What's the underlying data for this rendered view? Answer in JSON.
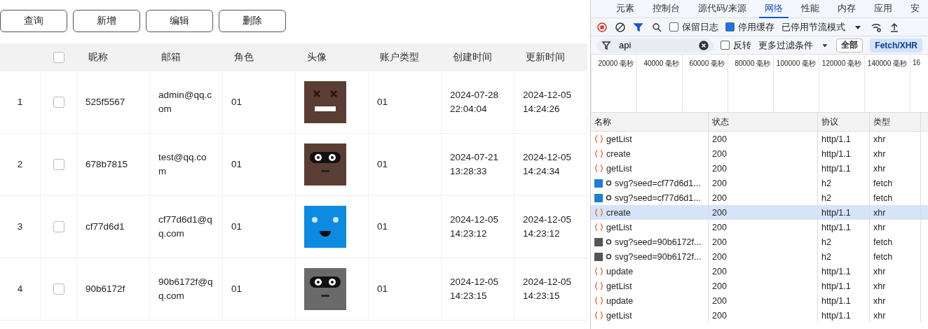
{
  "toolbar_buttons": [
    "查询",
    "新增",
    "编辑",
    "删除"
  ],
  "table": {
    "columns": [
      "昵称",
      "邮箱",
      "角色",
      "头像",
      "账户类型",
      "创建时间",
      "更新时间"
    ],
    "header_checked": false,
    "rows": [
      {
        "index": "1",
        "checked": false,
        "nickname": "525f5567",
        "email": "admin@qq.com",
        "role": "01",
        "avatar": {
          "kind": "x-eyes",
          "color": "#5a3d33"
        },
        "account_type": "01",
        "created": "2024-07-28 22:04:04",
        "updated": "2024-12-05 14:24:26"
      },
      {
        "index": "2",
        "checked": false,
        "nickname": "678b7815",
        "email": "test@qq.com",
        "role": "01",
        "avatar": {
          "kind": "goggles",
          "color": "#5a3d33"
        },
        "account_type": "01",
        "created": "2024-07-21 13:28:33",
        "updated": "2024-12-05 14:24:34"
      },
      {
        "index": "3",
        "checked": false,
        "nickname": "cf77d6d1",
        "email": "cf77d6d1@qq.com",
        "role": "01",
        "avatar": {
          "kind": "glow",
          "color": "#0d8be0"
        },
        "account_type": "01",
        "created": "2024-12-05 14:23:12",
        "updated": "2024-12-05 14:23:12"
      },
      {
        "index": "4",
        "checked": false,
        "nickname": "90b6172f",
        "email": "90b6172f@qq.com",
        "role": "01",
        "avatar": {
          "kind": "goggles",
          "color": "#6a6a6a"
        },
        "account_type": "01",
        "created": "2024-12-05 14:23:15",
        "updated": "2024-12-05 14:23:15"
      }
    ]
  },
  "devtools": {
    "tabs": [
      {
        "label": "元素",
        "selected": false
      },
      {
        "label": "控制台",
        "selected": false
      },
      {
        "label": "源代码/来源",
        "selected": false
      },
      {
        "label": "网络",
        "selected": true
      },
      {
        "label": "性能",
        "selected": false
      },
      {
        "label": "内存",
        "selected": false
      },
      {
        "label": "应用",
        "selected": false
      },
      {
        "label": "安",
        "selected": false
      }
    ],
    "preserve_log": {
      "label": "保留日志",
      "checked": false
    },
    "disable_cache": {
      "label": "停用缓存",
      "checked": true
    },
    "throttling": "已停用节流模式",
    "filter": {
      "value": "api"
    },
    "invert": {
      "label": "反转",
      "checked": false
    },
    "more_filters": "更多过滤条件",
    "type_filters": [
      {
        "label": "全部",
        "selected": false
      },
      {
        "label": "Fetch/XHR",
        "selected": true
      }
    ],
    "timeline_labels": [
      "20000 毫秒",
      "40000 毫秒",
      "60000 毫秒",
      "80000 毫秒",
      "100000 毫秒",
      "120000 毫秒",
      "140000 毫秒",
      "16"
    ],
    "columns": [
      "名称",
      "状态",
      "协议",
      "类型"
    ],
    "requests": [
      {
        "kind": "xhr",
        "name": "getList",
        "status": "200",
        "protocol": "http/1.1",
        "type": "xhr",
        "selected": false
      },
      {
        "kind": "xhr",
        "name": "create",
        "status": "200",
        "protocol": "http/1.1",
        "type": "xhr",
        "selected": false
      },
      {
        "kind": "xhr",
        "name": "getList",
        "status": "200",
        "protocol": "http/1.1",
        "type": "xhr",
        "selected": false
      },
      {
        "kind": "image",
        "color": "#1a7fd6",
        "name": "svg?seed=cf77d6d1...",
        "status": "200",
        "protocol": "h2",
        "type": "fetch",
        "selected": false
      },
      {
        "kind": "image",
        "color": "#1a7fd6",
        "name": "svg?seed=cf77d6d1...",
        "status": "200",
        "protocol": "h2",
        "type": "fetch",
        "selected": false
      },
      {
        "kind": "xhr",
        "name": "create",
        "status": "200",
        "protocol": "http/1.1",
        "type": "xhr",
        "selected": true
      },
      {
        "kind": "xhr",
        "name": "getList",
        "status": "200",
        "protocol": "http/1.1",
        "type": "xhr",
        "selected": false
      },
      {
        "kind": "image",
        "color": "#555555",
        "name": "svg?seed=90b6172f...",
        "status": "200",
        "protocol": "h2",
        "type": "fetch",
        "selected": false
      },
      {
        "kind": "image",
        "color": "#555555",
        "name": "svg?seed=90b6172f...",
        "status": "200",
        "protocol": "h2",
        "type": "fetch",
        "selected": false
      },
      {
        "kind": "xhr",
        "name": "update",
        "status": "200",
        "protocol": "http/1.1",
        "type": "xhr",
        "selected": false
      },
      {
        "kind": "xhr",
        "name": "getList",
        "status": "200",
        "protocol": "http/1.1",
        "type": "xhr",
        "selected": false
      },
      {
        "kind": "xhr",
        "name": "update",
        "status": "200",
        "protocol": "http/1.1",
        "type": "xhr",
        "selected": false
      },
      {
        "kind": "xhr",
        "name": "getList",
        "status": "200",
        "protocol": "http/1.1",
        "type": "xhr",
        "selected": false
      }
    ]
  }
}
